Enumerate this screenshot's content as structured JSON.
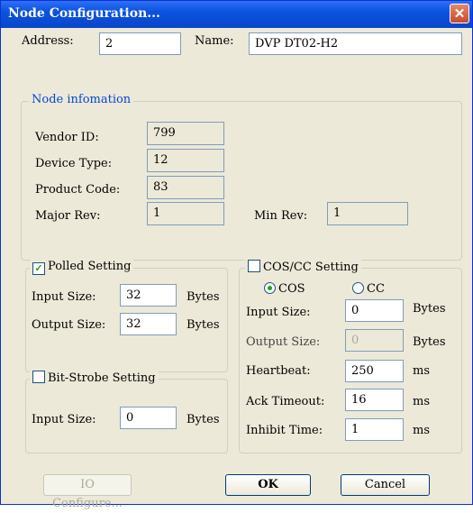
{
  "window": {
    "title": "Node Configuration..."
  },
  "address": {
    "label": "Address:",
    "value": "2"
  },
  "name": {
    "label": "Name:",
    "value": "DVP DT02-H2"
  },
  "node_info": {
    "legend": "Node infomation",
    "vendor_id_label": "Vendor ID:",
    "vendor_id": "799",
    "device_type_label": "Device Type:",
    "device_type": "12",
    "product_code_label": "Product Code:",
    "product_code": "83",
    "major_rev_label": "Major Rev:",
    "major_rev": "1",
    "min_rev_label": "Min Rev:",
    "min_rev": "1"
  },
  "polled": {
    "legend": "Polled Setting",
    "checked": true,
    "input_label": "Input Size:",
    "input_value": "32",
    "input_unit": "Bytes",
    "output_label": "Output Size:",
    "output_value": "32",
    "output_unit": "Bytes"
  },
  "bit_strobe": {
    "legend": "Bit-Strobe Setting",
    "checked": false,
    "input_label": "Input Size:",
    "input_value": "0",
    "input_unit": "Bytes"
  },
  "cos_cc": {
    "legend": "COS/CC Setting",
    "checked": false,
    "radio_cos": "COS",
    "radio_cc": "CC",
    "selected": "COS",
    "input_label": "Input Size:",
    "input_value": "0",
    "input_unit": "Bytes",
    "output_label": "Output Size:",
    "output_value": "0",
    "output_unit": "Bytes",
    "heartbeat_label": "Heartbeat:",
    "heartbeat_value": "250",
    "heartbeat_unit": "ms",
    "ack_label": "Ack Timeout:",
    "ack_value": "16",
    "ack_unit": "ms",
    "inhibit_label": "Inhibit Time:",
    "inhibit_value": "1",
    "inhibit_unit": "ms"
  },
  "buttons": {
    "io_configure": "IO Configure...",
    "ok": "OK",
    "cancel": "Cancel"
  }
}
